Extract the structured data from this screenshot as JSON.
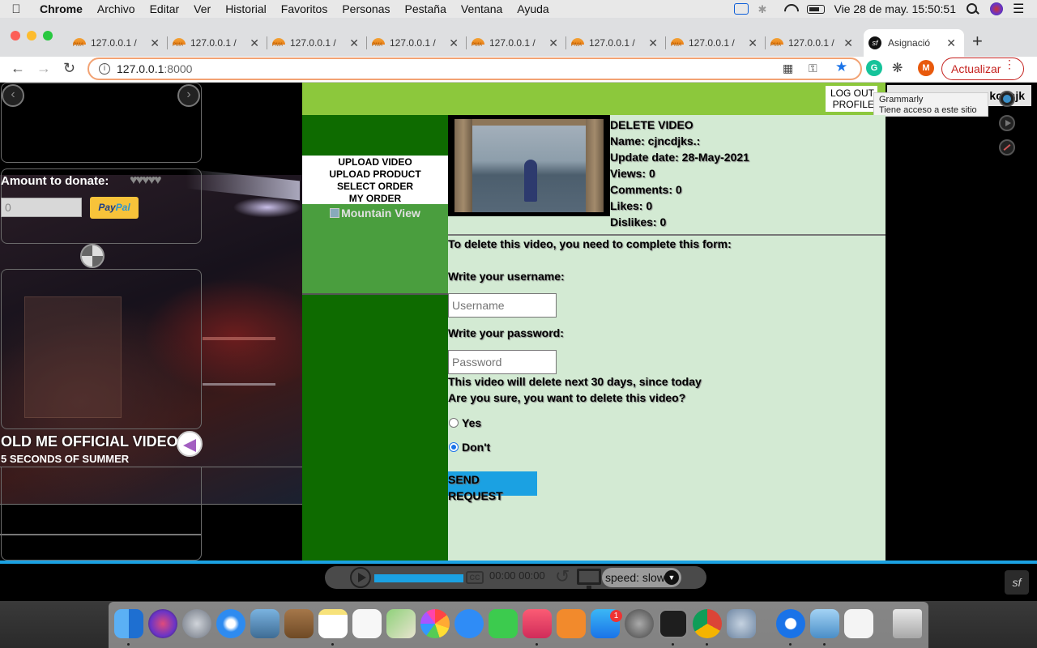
{
  "menubar": {
    "app": "Chrome",
    "items": [
      "Archivo",
      "Editar",
      "Ver",
      "Historial",
      "Favoritos",
      "Personas",
      "Pestaña",
      "Ventana",
      "Ayuda"
    ],
    "clock": "Vie 28 de may.  15:50:51"
  },
  "tabs": [
    {
      "label": "127.0.0.1 /"
    },
    {
      "label": "127.0.0.1 /"
    },
    {
      "label": "127.0.0.1 /"
    },
    {
      "label": "127.0.0.1 /"
    },
    {
      "label": "127.0.0.1 /"
    },
    {
      "label": "127.0.0.1 /"
    },
    {
      "label": "127.0.0.1 /"
    },
    {
      "label": "127.0.0.1 /"
    }
  ],
  "active_tab": {
    "label": "Asignació"
  },
  "toolbar": {
    "url_host": "127.0.0.1",
    "url_port": ":8000",
    "profile_initial": "M",
    "update_label": "Actualizar"
  },
  "left_panel": {
    "donate_label": "Amount to donate:",
    "donate_value": "0",
    "paypal_label_a": "Pay",
    "paypal_label_b": "Pal",
    "video_title": "OLD ME OFFICIAL VIDEO",
    "video_artist": "5 SECONDS OF SUMMER"
  },
  "header": {
    "logout": "LOG OUT",
    "profile": "PROFILE",
    "username_a": "",
    "username_b": "kcnsjk"
  },
  "tooltip": {
    "title": "Grammarly",
    "text": "Tiene acceso a este sitio"
  },
  "sidebar": {
    "items": [
      "UPLOAD VIDEO",
      "UPLOAD PRODUCT",
      "SELECT ORDER",
      "MY ORDER"
    ],
    "image_alt": "Mountain View"
  },
  "video_info": {
    "heading": "DELETE VIDEO",
    "name": "Name: cjncdjks.:",
    "update_date": "Update date: 28-May-2021",
    "views": "Views: 0",
    "comments": "Comments: 0",
    "likes": "Likes: 0",
    "dislikes": "Dislikes: 0"
  },
  "form": {
    "intro": "To delete this video, you need to complete this form:",
    "username_label": "Write your username:",
    "username_placeholder": "Username",
    "password_label": "Write your password:",
    "password_placeholder": "Password",
    "notice": "This video will delete next 30 days, since today",
    "question": "Are you sure, you want to delete this video?",
    "option_yes": "Yes",
    "option_no": "Don't",
    "selected": "Don't",
    "submit_label": "SEND REQUEST"
  },
  "player": {
    "cc": "CC",
    "time": "00:00 00:00",
    "speed": "speed: slowe",
    "progress": 0.6
  },
  "dock": {
    "badge": "1"
  },
  "colors": {
    "topbar": "#8cc83c",
    "sidebar": "#0e6b00",
    "content": "#d3ead3",
    "accent": "#1ba1e2"
  }
}
